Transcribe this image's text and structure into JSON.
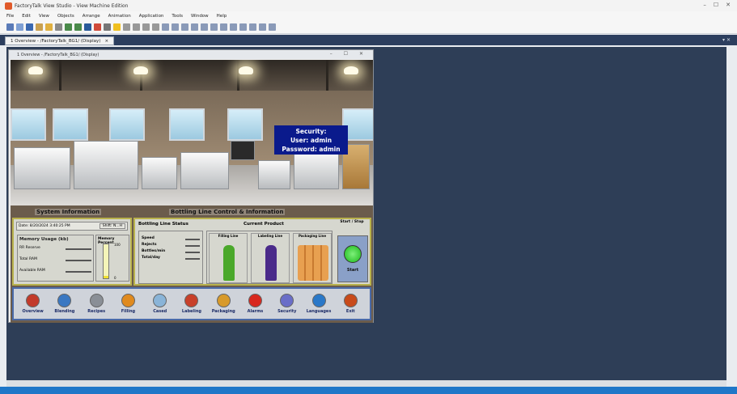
{
  "window": {
    "title": "FactoryTalk View Studio - View Machine Edition",
    "controls": [
      "–",
      "☐",
      "✕"
    ]
  },
  "menu": [
    "File",
    "Edit",
    "View",
    "Objects",
    "Arrange",
    "Animation",
    "Application",
    "Tools",
    "Window",
    "Help"
  ],
  "tab": {
    "label": "1 Overview - /FactoryTalk_BG1/ (Display)",
    "close": "×"
  },
  "child": {
    "title": "1 Overview - /FactoryTalk_BG1/ (Display)",
    "controls": "– ☐ ✕"
  },
  "hmi": {
    "security_box": {
      "line1": "Security:",
      "line2": "User: admin",
      "line3": "Password: admin"
    },
    "system_info_title": "System Information",
    "bottling_title": "Bottling Line Control & Information",
    "date": "Date: 8/20/2024 3:40:25 PM",
    "shift_label": "Shift: N...H",
    "memory_usage_label": "Memory Usage (kb)",
    "memory_percent_label": "Memory Percent",
    "memory_rows": [
      {
        "label": "RR Reserve"
      },
      {
        "label": "Total RAM"
      },
      {
        "label": "Available RAM"
      }
    ],
    "bar_top": "100",
    "bar_bottom": "0",
    "line_status_label": "Bottling Line Status",
    "current_product_label": "Current Product",
    "status_rows": [
      {
        "label": "Speed"
      },
      {
        "label": "Rejects"
      },
      {
        "label": "Bottles/min"
      },
      {
        "label": "Total/day"
      }
    ],
    "stations": [
      "Filling Line",
      "Labeling Line",
      "Packaging Line"
    ],
    "start_stop_label": "Start / Stop",
    "start_button": "Start"
  },
  "nav_buttons": [
    {
      "label": "Overview",
      "color": "#c23a2a"
    },
    {
      "label": "Blending",
      "color": "#3a78c2"
    },
    {
      "label": "Recipes",
      "color": "#8a8f96"
    },
    {
      "label": "Filling",
      "color": "#e08a1e"
    },
    {
      "label": "Cased",
      "color": "#8ab4d8"
    },
    {
      "label": "Labeling",
      "color": "#c8402a"
    },
    {
      "label": "Packaging",
      "color": "#d89a2a"
    },
    {
      "label": "Alarms",
      "color": "#d8281e"
    },
    {
      "label": "Security",
      "color": "#6a6ec8"
    },
    {
      "label": "Languages",
      "color": "#2a78c8"
    },
    {
      "label": "Exit",
      "color": "#c84a1a"
    }
  ]
}
